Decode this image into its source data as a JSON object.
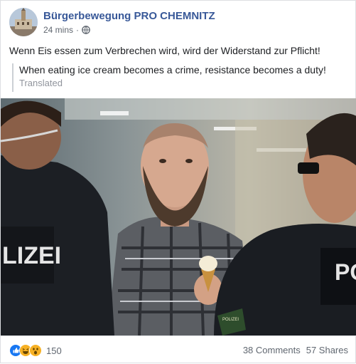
{
  "post": {
    "page_name": "Bürgerbewegung PRO CHEMNITZ",
    "timestamp": "24 mins",
    "separator": "·",
    "privacy_icon": "globe-icon",
    "text": "Wenn Eis essen zum Verbrechen wird, wird der Widerstand zur Pflicht!",
    "translation": {
      "text": "When eating ice cream becomes a crime, resistance becomes a duty!",
      "label": "Translated"
    },
    "photo": {
      "police_vest_left": "LIZEI",
      "police_vest_right": "PO",
      "badge_text": "POLIZEI"
    }
  },
  "footer": {
    "reaction_icons": [
      "like-icon",
      "haha-icon",
      "wow-icon"
    ],
    "reaction_count": "150",
    "comments": "38 Comments",
    "shares": "57 Shares"
  },
  "colors": {
    "link_blue": "#385898",
    "meta_gray": "#606770",
    "like_blue": "#1877f2",
    "emoji_yellow": "#f7b125"
  }
}
